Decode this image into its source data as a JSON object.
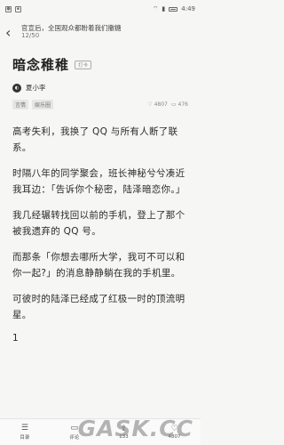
{
  "status_bar": {
    "time": "4:49"
  },
  "nav": {
    "title": "官宣后，全国观众都盼着我们撒糖",
    "progress": "12/50"
  },
  "chapter": {
    "title": "暗念稚稚",
    "badge": "打卡"
  },
  "author": {
    "name": "夏小李"
  },
  "meta": {
    "tags": [
      "言情",
      "娱乐圈"
    ],
    "likes": "4807",
    "comments": "476"
  },
  "content": {
    "paragraphs": [
      "高考失利，我换了 QQ 与所有人断了联系。",
      "时隔八年的同学聚会，班长神秘兮兮凑近我耳边：「告诉你个秘密，陆泽暗恋你。」",
      "我几经辗转找回以前的手机，登上了那个被我遗弃的 QQ 号。",
      "而那条「你想去哪所大学，我可不可以和你一起?」的消息静静躺在我的手机里。",
      "可彼时的陆泽已经成了红极一时的顶流明星。"
    ],
    "section_number": "1"
  },
  "bottom_bar": {
    "items": [
      {
        "icon": "list-icon",
        "label": "目录"
      },
      {
        "icon": "comment-icon",
        "label": "评论"
      },
      {
        "icon": "share-icon",
        "label": "133"
      },
      {
        "icon": "like-icon",
        "label": "4807"
      }
    ]
  },
  "watermark": "GASK.CC"
}
